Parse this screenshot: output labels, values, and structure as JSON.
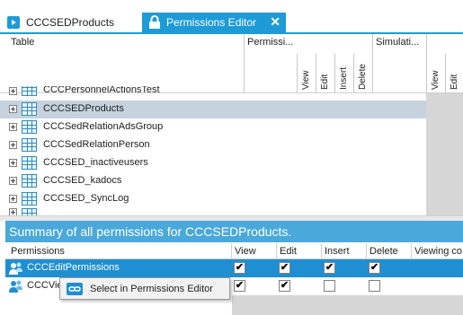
{
  "tabs": [
    {
      "label": "CCCSEDProducts",
      "active": false,
      "icon": "table-icon"
    },
    {
      "label": "Permissions Editor",
      "active": true,
      "icon": "lock-icon",
      "close_icon": "close-icon"
    }
  ],
  "upper_grid": {
    "columns": {
      "table": "Table",
      "permissions_group": "Permissi...",
      "simulation_group": "Simulati..."
    },
    "rotated_headers": [
      "View",
      "Edit",
      "Insert",
      "Delete",
      "View",
      "Edit"
    ],
    "rows": [
      {
        "label": "CCCPersonnelActionsTest",
        "selected": false
      },
      {
        "label": "CCCSEDProducts",
        "selected": true
      },
      {
        "label": "CCCSedRelationAdsGroup",
        "selected": false
      },
      {
        "label": "CCCSedRelationPerson",
        "selected": false
      },
      {
        "label": "CCCSED_inactiveusers",
        "selected": false
      },
      {
        "label": "CCCSED_kadocs",
        "selected": false
      },
      {
        "label": "CCCSED_SyncLog",
        "selected": false
      }
    ]
  },
  "summary": {
    "title": "Summary of all permissions for CCCSEDProducts.",
    "columns": [
      "Permissions",
      "View",
      "Edit",
      "Insert",
      "Delete",
      "Viewing co"
    ],
    "rows": [
      {
        "label": "CCCEditPermissions",
        "view": true,
        "edit": true,
        "insert": true,
        "delete": true,
        "selected": true
      },
      {
        "label": "CCCVie",
        "view": true,
        "edit": true,
        "insert": false,
        "delete": false,
        "selected": false
      }
    ]
  },
  "context_menu": {
    "items": [
      {
        "label": "Select in Permissions Editor",
        "icon": "link-icon"
      }
    ]
  },
  "colors": {
    "accent": "#1e9bd7",
    "summary_bar": "#4aa8da",
    "selected_row": "#1e8fd2",
    "tree_selection": "#c6d3de"
  }
}
